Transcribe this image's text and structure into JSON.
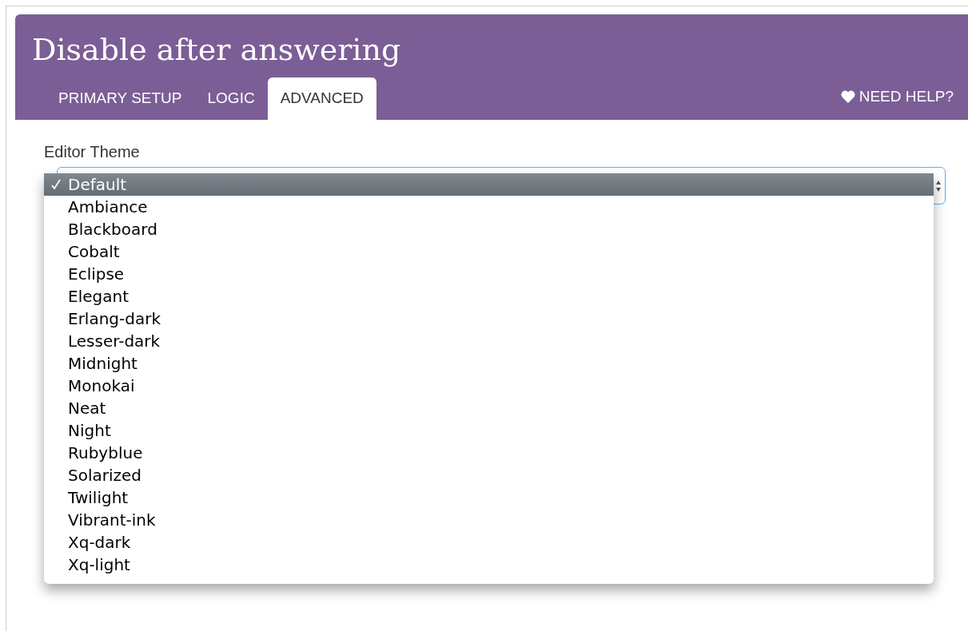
{
  "title": "Disable after answering",
  "tabs": [
    {
      "label": "PRIMARY SETUP",
      "selected": false
    },
    {
      "label": "LOGIC",
      "selected": false
    },
    {
      "label": "ADVANCED",
      "selected": true
    }
  ],
  "help_link": "NEED HELP?",
  "field": {
    "label": "Editor Theme"
  },
  "menu": [
    {
      "label": "Default",
      "selected": true
    },
    {
      "label": "Ambiance",
      "selected": false
    },
    {
      "label": "Blackboard",
      "selected": false
    },
    {
      "label": "Cobalt",
      "selected": false
    },
    {
      "label": "Eclipse",
      "selected": false
    },
    {
      "label": "Elegant",
      "selected": false
    },
    {
      "label": "Erlang-dark",
      "selected": false
    },
    {
      "label": "Lesser-dark",
      "selected": false
    },
    {
      "label": "Midnight",
      "selected": false
    },
    {
      "label": "Monokai",
      "selected": false
    },
    {
      "label": "Neat",
      "selected": false
    },
    {
      "label": "Night",
      "selected": false
    },
    {
      "label": "Rubyblue",
      "selected": false
    },
    {
      "label": "Solarized",
      "selected": false
    },
    {
      "label": "Twilight",
      "selected": false
    },
    {
      "label": "Vibrant-ink",
      "selected": false
    },
    {
      "label": "Xq-dark",
      "selected": false
    },
    {
      "label": "Xq-light",
      "selected": false
    }
  ]
}
